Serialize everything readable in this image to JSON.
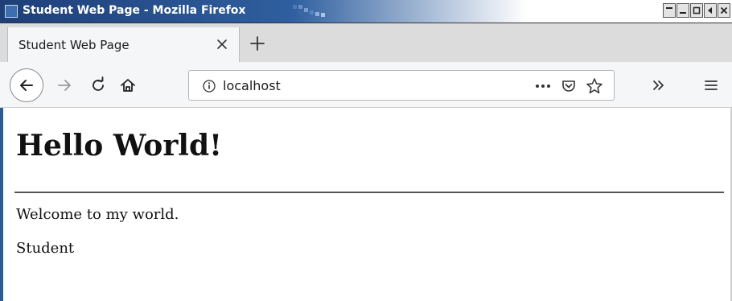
{
  "window": {
    "title": "Student Web Page - Mozilla Firefox"
  },
  "tabs": [
    {
      "label": "Student Web Page",
      "active": true
    }
  ],
  "toolbar": {
    "url": "localhost"
  },
  "page": {
    "heading": "Hello World!",
    "paragraphs": [
      "Welcome to my world.",
      "Student"
    ]
  },
  "icons": {
    "window": "window-icon",
    "close_tab": "close-icon",
    "new_tab": "plus-icon",
    "back": "back-arrow-icon",
    "forward": "forward-arrow-icon",
    "reload": "reload-icon",
    "home": "home-icon",
    "info": "info-icon",
    "page_actions": "more-horizontal-icon",
    "pocket": "pocket-icon",
    "bookmark": "star-icon",
    "overflow": "double-chevron-icon",
    "menu": "hamburger-menu-icon"
  },
  "colors": {
    "titlebar": "#1e3f78",
    "toolbar": "#f5f6f7",
    "tabstrip": "#dcdcdc",
    "page_background": "#ffffff",
    "text": "#111111"
  }
}
